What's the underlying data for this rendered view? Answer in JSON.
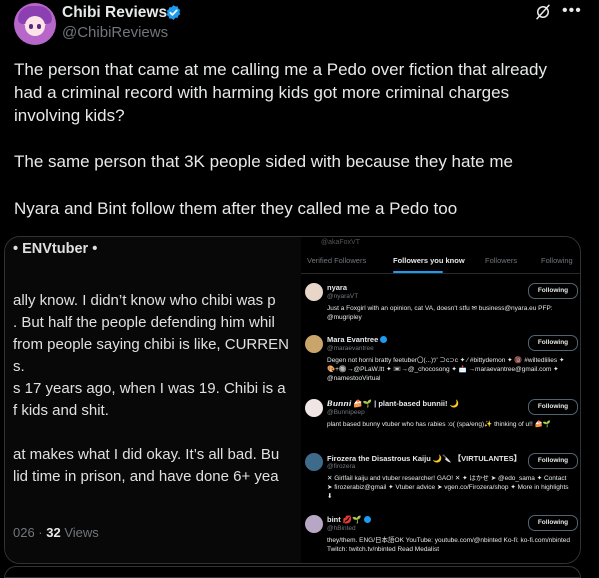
{
  "header": {
    "display_name": "Chibi Reviews",
    "handle": "@ChibiReviews"
  },
  "tweet": {
    "p1_line1": "The person that came at me calling me a Pedo over fiction that already",
    "p1_line2": "had a criminal record with harming kids got more criminal charges",
    "p1_line3": "involving kids?",
    "p2": "The same person that 3K people sided with because they hate me",
    "p3": "Nyara and Bint follow them after they called me a Pedo too"
  },
  "media_left": {
    "title": "• ENVtuber •",
    "lines": [
      "ally know. I didn’t know who chibi was p",
      ". But half the people defending him whil",
      "from people saying chibi is like, CURREN",
      "s.",
      "s 17 years ago, when I was 19. Chibi is a",
      "f kids and shit.",
      "at makes what I did okay. It’s all bad. Bu",
      "lid time in prison, and have done 6+ yea"
    ],
    "views_prefix": "026 · ",
    "views_count": "32",
    "views_label": " Views"
  },
  "media_right": {
    "ghost_handle": "@akaFoxVT",
    "tabs": [
      "Verified Followers",
      "Followers you know",
      "Followers",
      "Following"
    ],
    "follow_label": "Following",
    "rows": [
      {
        "name": "nyara",
        "handle": "@nyaraVT",
        "bio": "Just a Foxgirl with an opinion, cat VA, doesn't stfu ✉ business@nyara.eu PFP: @mugripley",
        "avatar_color": "#e8d6c8"
      },
      {
        "name": "Mara Evantree",
        "handle": "@maraevantree",
        "bio": "Degen not horni bratty feetuber〇(...)ﾂ' ⊃c⊃c ✦ ⁄ #bittydemon ✦ 🔞 #wiltedlilies ✦ 🎨+🔘→@PLaW.ltt ✦ 📼→@_chocosong ✦ 📩 →maraevantree@gmail.com ✦ @namestooVirtual",
        "avatar_color": "#c9a56b"
      },
      {
        "name": "𝘽𝙪𝙣𝙣𝙞 🍰🌱 | plant-based bunnii! 🌙",
        "handle": "@Bunnipeep",
        "bio": "plant based bunny vtuber who has rabies :o( (spa/eng)✨ thinking of u!! 🍰🌱",
        "avatar_color": "#f1e6e6"
      },
      {
        "name": "Firozera the Disastrous Kaiju 🌙🔪 【VIRTULANTES】",
        "handle": "@firozera",
        "bio": "✕ Girlfail kaiju and vtuber researcher! GAO! ✕ ✦ はかせ ➤ @edo_sama ✦ Contact ➤ firozerabiz@gmail ✦ Vtuber advice ➤ vgen.co/Firozera/shop ✦ More in highlights ⬇",
        "avatar_color": "#3f6b8a"
      },
      {
        "name": "bint 💋🌱",
        "handle": "@hBinted",
        "bio": "they/them. ENG/日本語OK YouTube: youtube.com/@nbinted Ko-fi: ko-fi.com/nbinted Twitch: twitch.tv/nbinted Read Medalist",
        "avatar_color": "#b8a7c4"
      }
    ]
  },
  "colors": {
    "background": "#000000",
    "text": "#e7e9ea",
    "muted": "#71767b",
    "accent": "#1d9bf0",
    "border": "#2f3336"
  },
  "icons": [
    "verified-badge-icon",
    "grok-icon",
    "more-icon"
  ]
}
